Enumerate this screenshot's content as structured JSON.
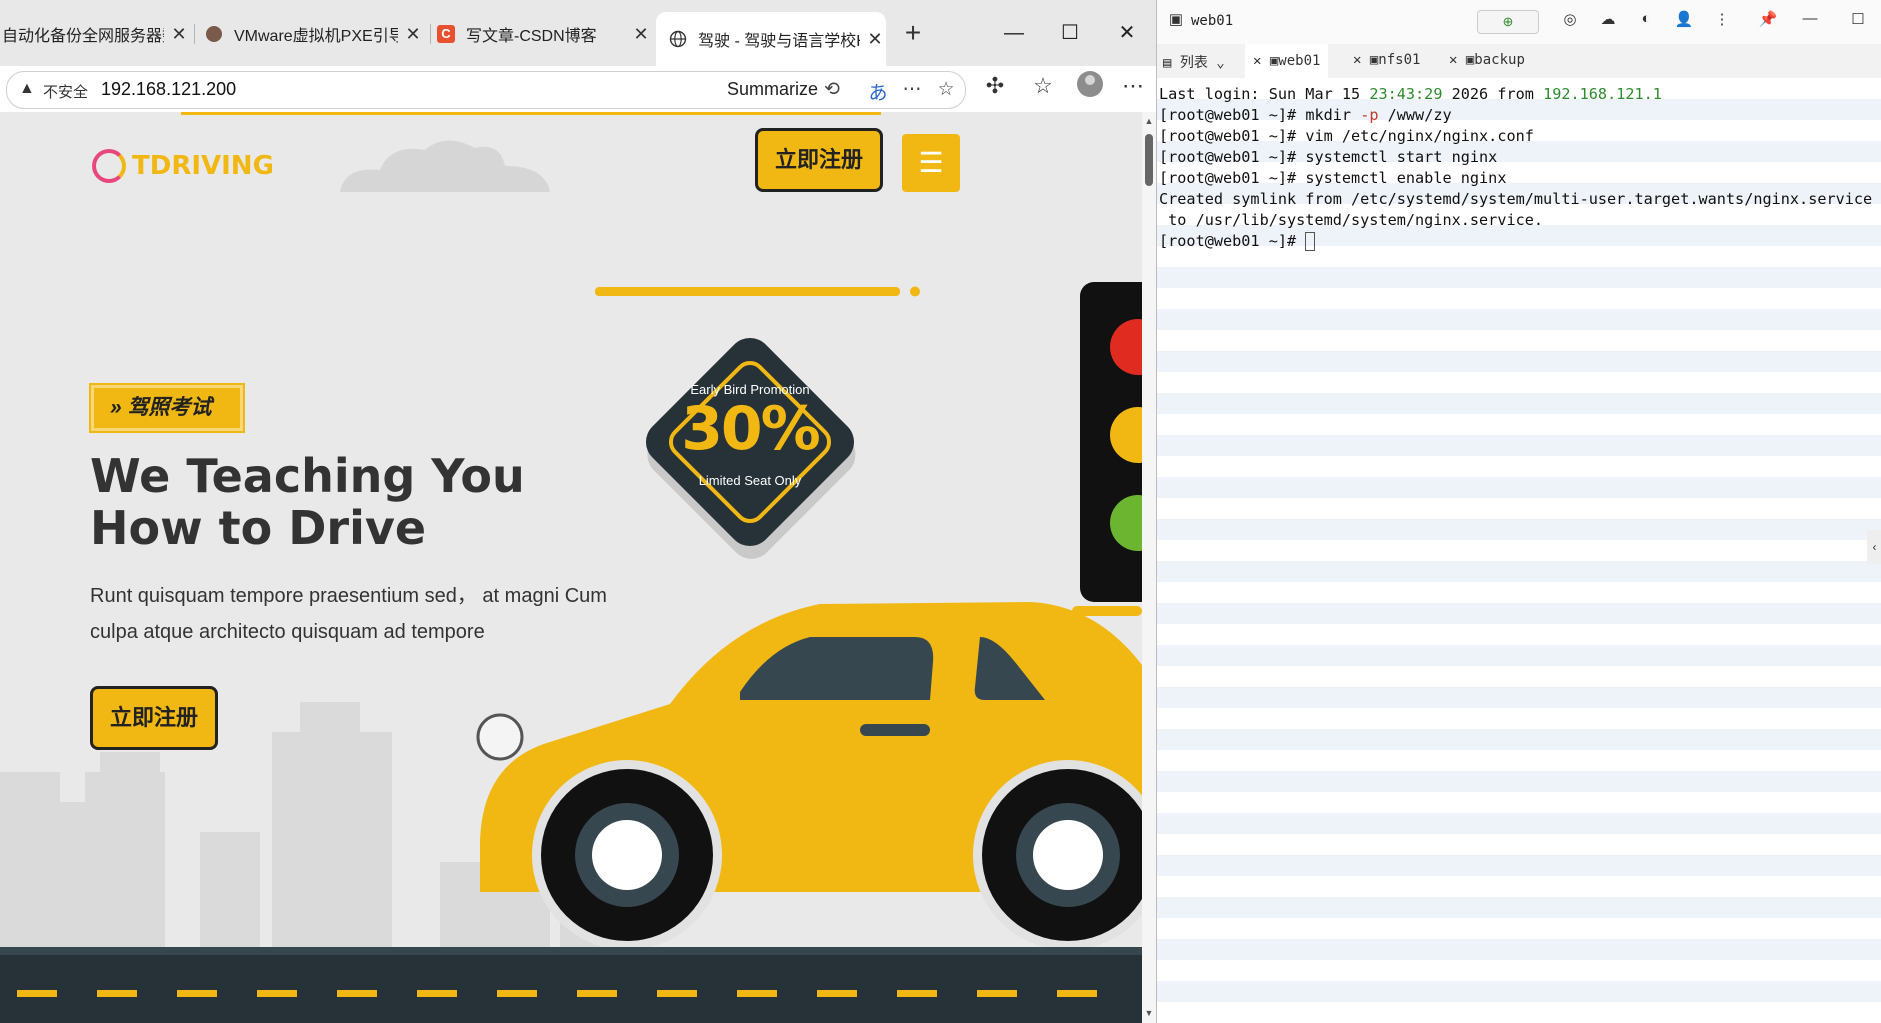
{
  "browser": {
    "tabs": [
      {
        "label": "自动化备份全网服务器数",
        "active": false
      },
      {
        "label": "VMware虚拟机PXE引导",
        "active": false
      },
      {
        "label": "写文章-CSDN博客",
        "active": false
      },
      {
        "label": "驾驶 - 驾驶与语言学校H",
        "active": true
      }
    ],
    "new_tab": "+",
    "window_controls": {
      "minimize": "—",
      "maximize": "☐",
      "close": "✕"
    },
    "address": {
      "security_label": "不安全",
      "url": "192.168.121.200",
      "summarize_label": "Summarize"
    }
  },
  "site": {
    "logo_text": "TDRIVING",
    "header_cta": "立即注册",
    "menu_icon": "☰",
    "badge_text": "» 驾照考试",
    "hero_title_line1": "We Teaching You",
    "hero_title_line2": "How to Drive",
    "hero_desc_line1": "Runt quisquam tempore praesentium sed， at magni Cum",
    "hero_desc_line2": "culpa atque architecto quisquam ad tempore",
    "hero_cta": "立即注册",
    "promo": {
      "top": "Early Bird Promotion",
      "big": "30%",
      "bottom": "Limited Seat Only"
    }
  },
  "terminal": {
    "window_title": "web01",
    "tabs": [
      {
        "label": "列表",
        "active": false
      },
      {
        "label": "web01",
        "active": true
      },
      {
        "label": "nfs01",
        "active": false
      },
      {
        "label": "backup",
        "active": false
      }
    ],
    "lines": {
      "l1_a": "Last login: Sun Mar 15 ",
      "l1_time": "23:43:29",
      "l1_b": " 2026 from ",
      "l1_ip": "192.168.121.1",
      "prompt": "[root@web01 ~]# ",
      "l2_a": "mkdir ",
      "l2_flag": "-p",
      "l2_b": " /www/zy",
      "l3": "vim /etc/nginx/nginx.conf",
      "l4": "systemctl start nginx",
      "l5": "systemctl enable nginx",
      "l6": "Created symlink from /etc/systemd/system/multi-user.target.wants/nginx.service",
      "l7": " to /usr/lib/systemd/system/nginx.service."
    }
  },
  "colors": {
    "accent_yellow": "#f1b814",
    "dark": "#263238",
    "terminal_green": "#2e8b2e",
    "terminal_red": "#c0392b"
  }
}
